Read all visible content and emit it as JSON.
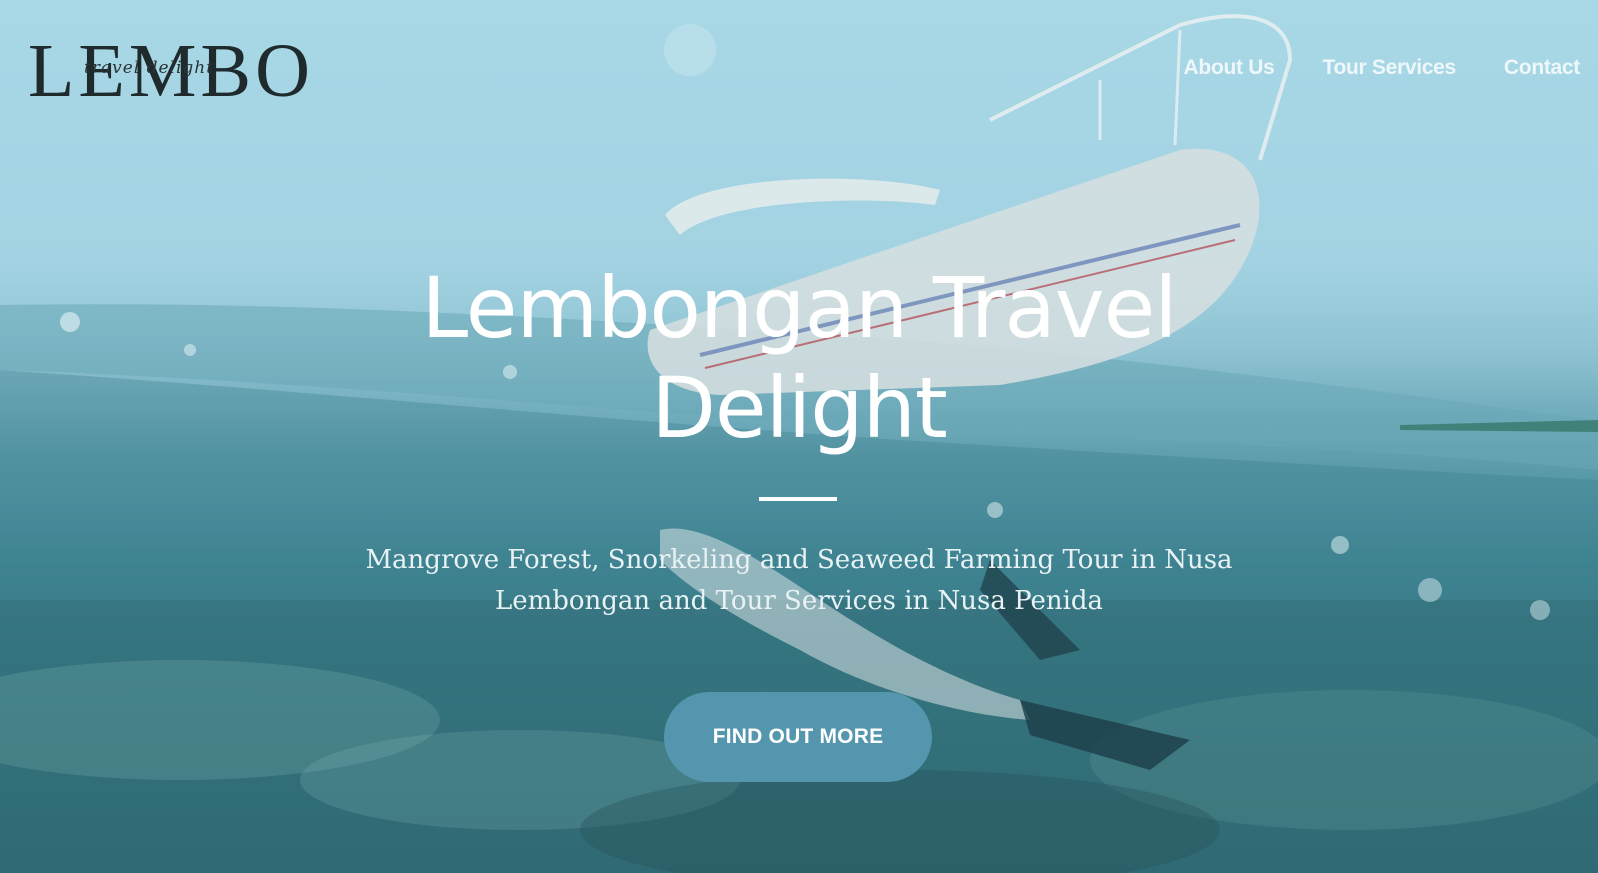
{
  "brand": {
    "logo_main": "LEMBO",
    "logo_sub": "travel delight"
  },
  "nav": {
    "items": [
      {
        "label": "About Us"
      },
      {
        "label": "Tour Services"
      },
      {
        "label": "Contact"
      }
    ]
  },
  "hero": {
    "title_line1": "Lembongan Travel",
    "title_line2": "Delight",
    "subtitle_line1": "Mangrove Forest, Snorkeling and Seaweed Farming Tour in Nusa",
    "subtitle_line2": "Lembongan and Tour Services in Nusa Penida",
    "cta_label": "FIND OUT MORE"
  },
  "colors": {
    "sky": "#a8d8e6",
    "water": "#3f8593",
    "button": "#5396ad",
    "text_light": "#ffffff"
  }
}
